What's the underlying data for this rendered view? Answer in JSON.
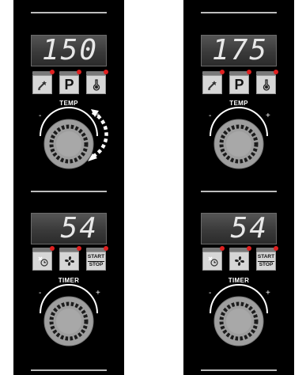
{
  "panels": [
    {
      "temp": {
        "display": "150",
        "buttons": [
          {
            "icon": "wand-icon"
          },
          {
            "icon": "preset-p-icon",
            "label": "P"
          },
          {
            "icon": "thermometer-probe-icon"
          }
        ],
        "knob_label": "TEMP",
        "minus": "-",
        "plus": "+"
      },
      "timer": {
        "display": "54",
        "buttons": [
          {
            "icon": "timer-icon"
          },
          {
            "icon": "fan-icon"
          },
          {
            "icon": "start-stop-icon",
            "label_top": "START",
            "label_bottom": "STOP"
          }
        ],
        "knob_label": "TIMER",
        "minus": "-",
        "plus": "+"
      },
      "rotation_arrow": "rotate-clockwise-arrow-icon"
    },
    {
      "temp": {
        "display": "175",
        "buttons": [
          {
            "icon": "wand-icon"
          },
          {
            "icon": "preset-p-icon",
            "label": "P"
          },
          {
            "icon": "thermometer-probe-icon"
          }
        ],
        "knob_label": "TEMP",
        "minus": "-",
        "plus": "+"
      },
      "timer": {
        "display": "54",
        "buttons": [
          {
            "icon": "timer-icon"
          },
          {
            "icon": "fan-icon"
          },
          {
            "icon": "start-stop-icon",
            "label_top": "START",
            "label_bottom": "STOP"
          }
        ],
        "knob_label": "TIMER",
        "minus": "-",
        "plus": "+"
      }
    }
  ],
  "colors": {
    "panel_bg": "#000000",
    "display_bg": "#3a3a3a",
    "display_digits": "#e8e8e8",
    "led": "#e02020",
    "button_bg": "#d6d6d6",
    "knob": "#9a9a9a"
  }
}
